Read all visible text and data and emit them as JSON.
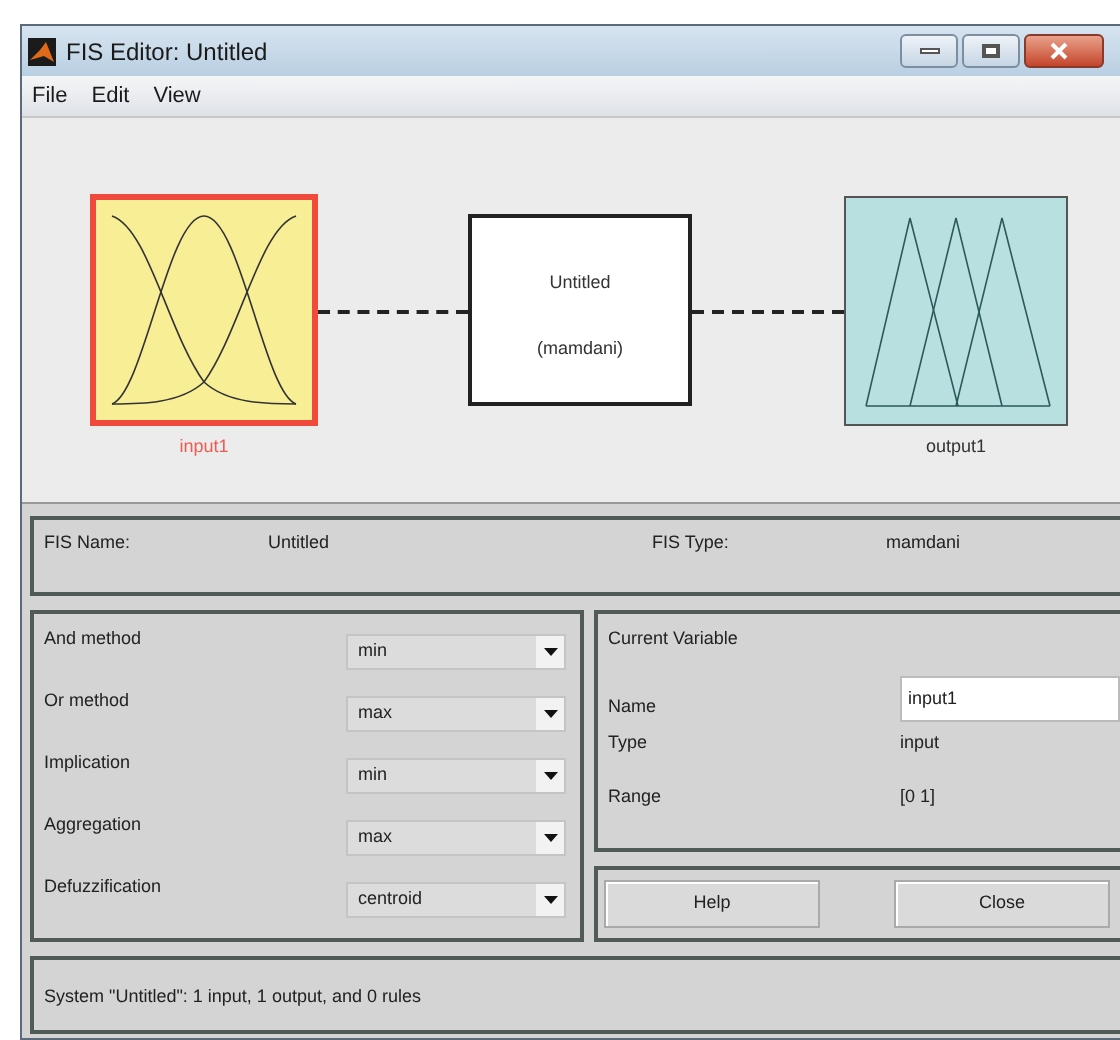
{
  "window": {
    "title": "FIS Editor: Untitled"
  },
  "menu": [
    "File",
    "Edit",
    "View"
  ],
  "diagram": {
    "inputs": [
      {
        "label": "input1",
        "selected": true
      }
    ],
    "system": {
      "name": "Untitled",
      "type": "(mamdani)"
    },
    "outputs": [
      {
        "label": "output1",
        "selected": false
      }
    ]
  },
  "fis_info": {
    "name_label": "FIS Name:",
    "name_value": "Untitled",
    "type_label": "FIS Type:",
    "type_value": "mamdani"
  },
  "methods": [
    {
      "label": "And method",
      "value": "min"
    },
    {
      "label": "Or method",
      "value": "max"
    },
    {
      "label": "Implication",
      "value": "min"
    },
    {
      "label": "Aggregation",
      "value": "max"
    },
    {
      "label": "Defuzzification",
      "value": "centroid"
    }
  ],
  "current_variable": {
    "title": "Current Variable",
    "name_label": "Name",
    "name_value": "input1",
    "type_label": "Type",
    "type_value": "input",
    "range_label": "Range",
    "range_value": "[0 1]"
  },
  "buttons": [
    "Help",
    "Close"
  ],
  "status": "System \"Untitled\": 1 input, 1 output, and 0 rules"
}
